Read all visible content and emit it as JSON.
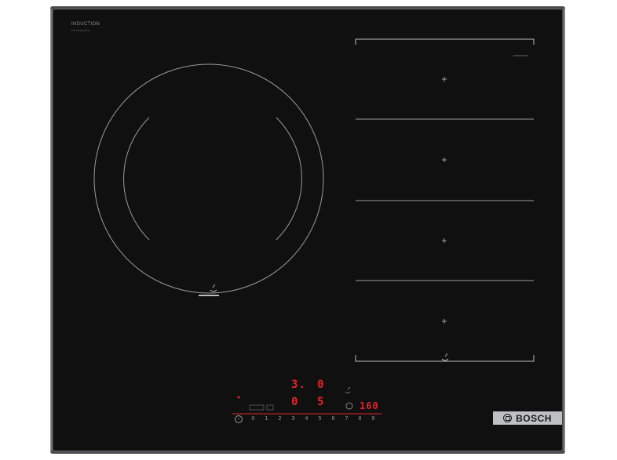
{
  "brand": {
    "model_text": "INDUCTION",
    "sub_text": "FlexInduction",
    "logo_text": "BOSCH"
  },
  "display": {
    "top_left": "3.",
    "top_right": "0",
    "mid_left": "0",
    "mid_right": "5",
    "timer": "160",
    "red_color": "#e0262b"
  },
  "power_scale": [
    "0",
    "1",
    "2",
    "3",
    "4",
    "5",
    "6",
    "7",
    "8",
    "9"
  ],
  "info_symbol": "i",
  "icons": [
    "info-icon",
    "pan-icon",
    "clock-icon",
    "plus-icon"
  ]
}
